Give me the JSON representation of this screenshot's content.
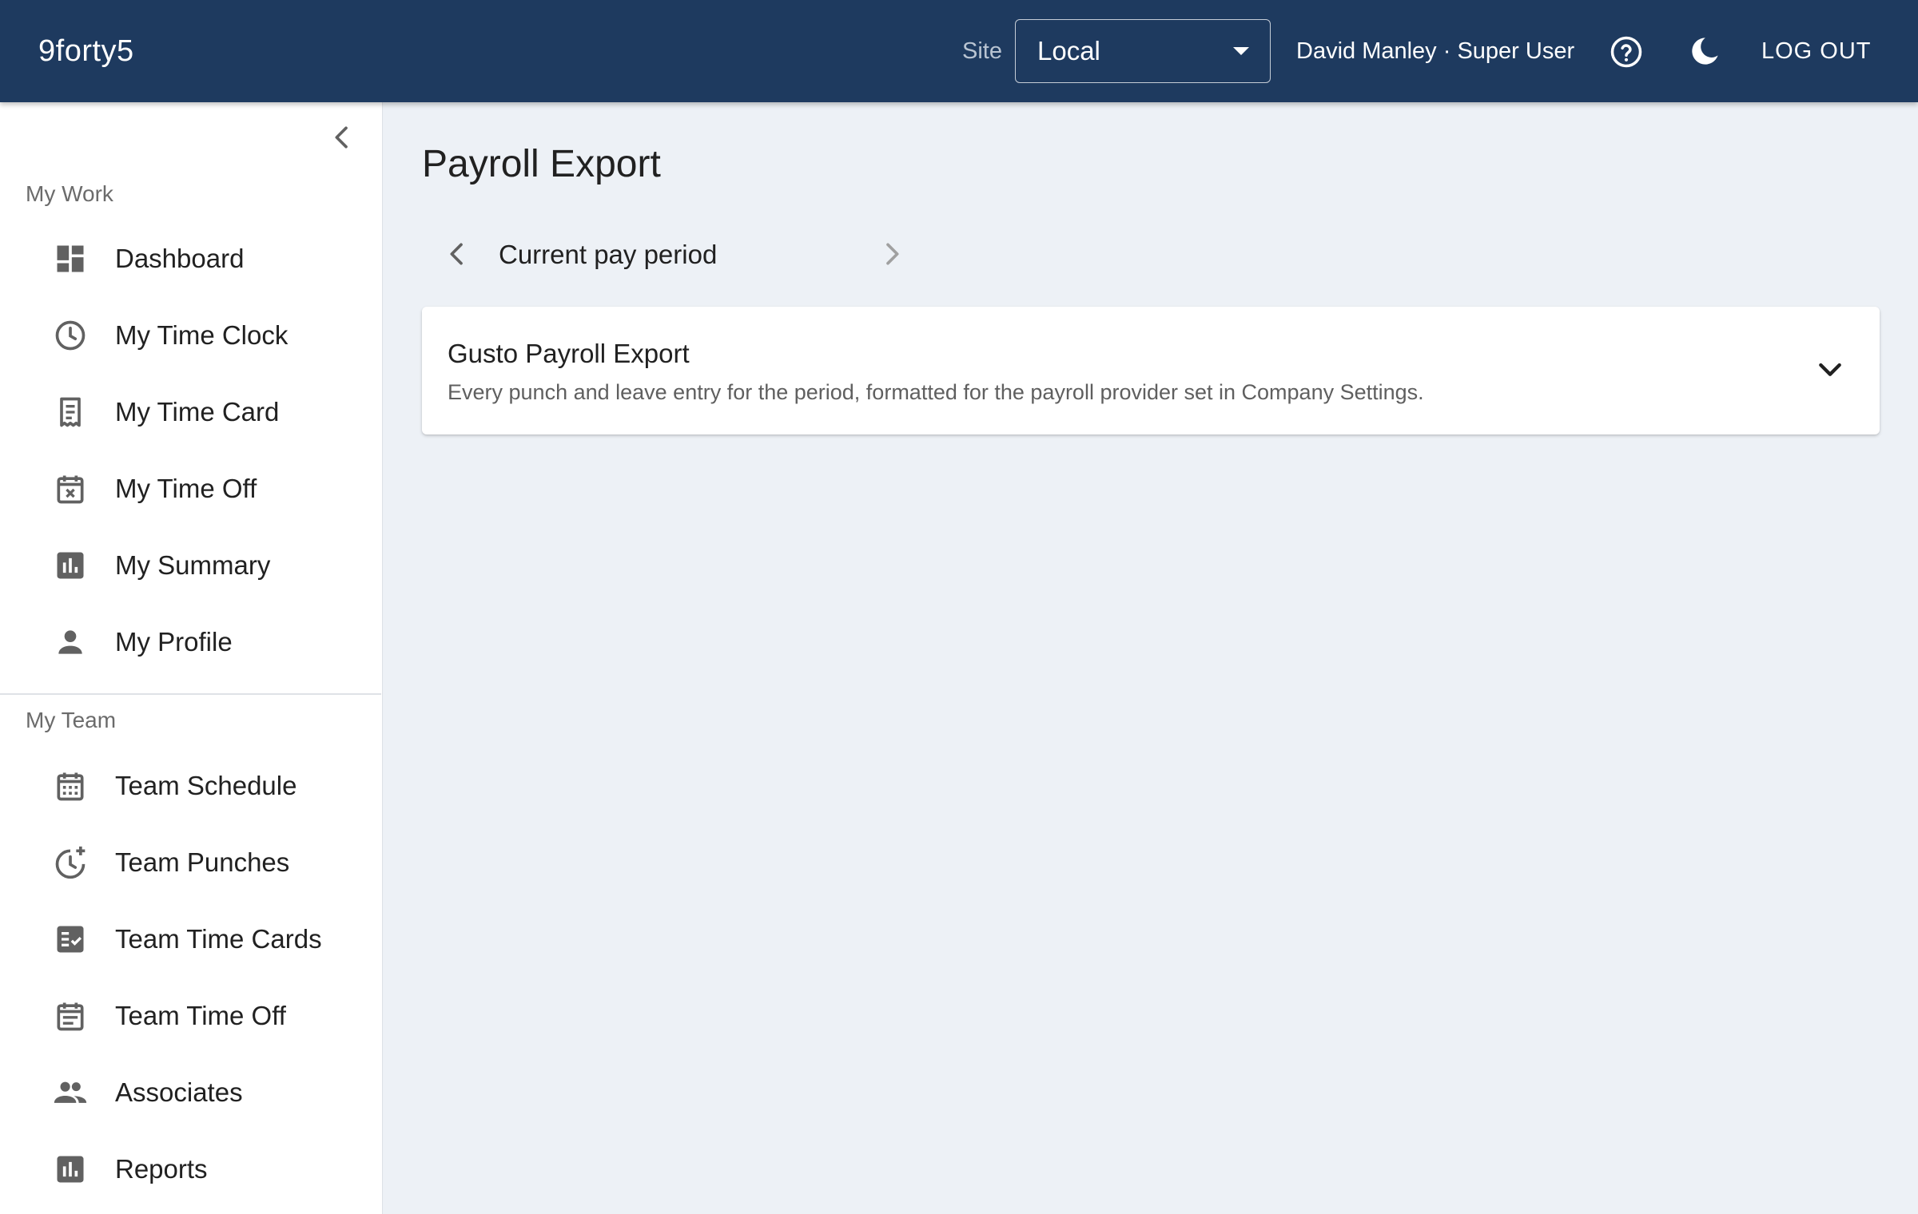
{
  "header": {
    "brand": "9forty5",
    "site_label": "Site",
    "site_value": "Local",
    "user": "David Manley · Super User",
    "logout_label": "LOG OUT"
  },
  "sidebar": {
    "my_work_title": "My Work",
    "my_work_items": [
      {
        "label": "Dashboard",
        "icon": "dashboard-icon"
      },
      {
        "label": "My Time Clock",
        "icon": "clock-icon"
      },
      {
        "label": "My Time Card",
        "icon": "receipt-icon"
      },
      {
        "label": "My Time Off",
        "icon": "calendar-x-icon"
      },
      {
        "label": "My Summary",
        "icon": "bar-chart-icon"
      },
      {
        "label": "My Profile",
        "icon": "person-icon"
      }
    ],
    "my_team_title": "My Team",
    "my_team_items": [
      {
        "label": "Team Schedule",
        "icon": "calendar-grid-icon"
      },
      {
        "label": "Team Punches",
        "icon": "clock-plus-icon"
      },
      {
        "label": "Team Time Cards",
        "icon": "checklist-icon"
      },
      {
        "label": "Team Time Off",
        "icon": "calendar-lines-icon"
      },
      {
        "label": "Associates",
        "icon": "people-icon"
      },
      {
        "label": "Reports",
        "icon": "bar-chart-icon"
      }
    ]
  },
  "main": {
    "page_title": "Payroll Export",
    "period_label": "Current pay period",
    "export_card": {
      "title": "Gusto Payroll Export",
      "description": "Every punch and leave entry for the period, formatted for the payroll provider set in Company Settings."
    }
  },
  "colors": {
    "appbar": "#1e3a5f",
    "background": "#edf1f6",
    "icon": "#616161"
  }
}
